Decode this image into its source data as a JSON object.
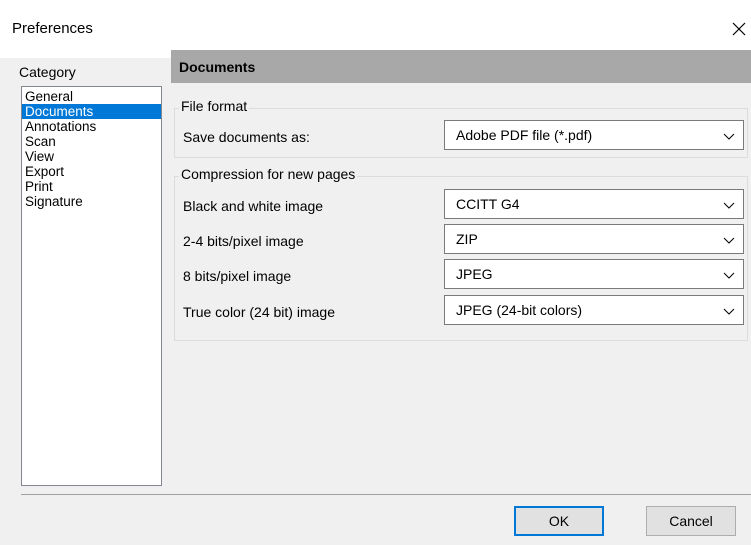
{
  "window": {
    "title": "Preferences"
  },
  "category": {
    "label": "Category",
    "items": [
      {
        "label": "General",
        "selected": false
      },
      {
        "label": "Documents",
        "selected": true
      },
      {
        "label": "Annotations",
        "selected": false
      },
      {
        "label": "Scan",
        "selected": false
      },
      {
        "label": "View",
        "selected": false
      },
      {
        "label": "Export",
        "selected": false
      },
      {
        "label": "Print",
        "selected": false
      },
      {
        "label": "Signature",
        "selected": false
      }
    ]
  },
  "content": {
    "header": "Documents",
    "file_format": {
      "legend": "File format",
      "save_as_label": "Save documents as:",
      "save_as_value": "Adobe PDF file (*.pdf)"
    },
    "compression": {
      "legend": "Compression for new pages",
      "rows": [
        {
          "label": "Black and white image",
          "value": "CCITT G4"
        },
        {
          "label": "2-4 bits/pixel image",
          "value": "ZIP"
        },
        {
          "label": "8 bits/pixel image",
          "value": "JPEG"
        },
        {
          "label": "True color (24 bit) image",
          "value": "JPEG (24-bit colors)"
        }
      ]
    }
  },
  "buttons": {
    "ok": "OK",
    "cancel": "Cancel"
  },
  "colors": {
    "selection": "#0078d7",
    "header_bg": "#a8a8a8",
    "dialog_bg": "#f0f0f0"
  }
}
